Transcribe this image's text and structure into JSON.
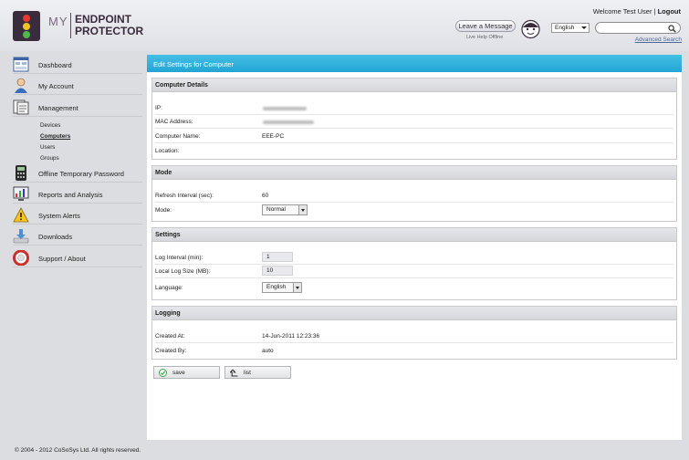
{
  "header": {
    "brand_my": "MY",
    "brand_line1": "ENDPOINT",
    "brand_line2": "PROTECTOR",
    "welcome_text": "Welcome Test User",
    "separator": "|",
    "logout_label": "Logout",
    "leave_message_label": "Leave a Message",
    "live_help_status": "Live Help Offline",
    "language_selected": "English",
    "search_value": "",
    "advanced_search_label": "Advanced Search"
  },
  "sidebar": {
    "items": [
      {
        "label": "Dashboard",
        "icon": "dashboard-icon"
      },
      {
        "label": "My Account",
        "icon": "user-icon"
      },
      {
        "label": "Management",
        "icon": "management-icon"
      },
      {
        "label": "Offline Temporary Password",
        "icon": "calculator-icon"
      },
      {
        "label": "Reports and Analysis",
        "icon": "reports-icon"
      },
      {
        "label": "System Alerts",
        "icon": "warning-icon"
      },
      {
        "label": "Downloads",
        "icon": "download-icon"
      },
      {
        "label": "Support / About",
        "icon": "lifebuoy-icon"
      }
    ],
    "management_sub": [
      "Devices",
      "Computers",
      "Users",
      "Groups"
    ],
    "active_sub": "Computers"
  },
  "main": {
    "title": "Edit Settings for Computer",
    "computer_details": {
      "heading": "Computer Details",
      "ip_label": "IP:",
      "mac_label": "MAC Address:",
      "name_label": "Computer Name:",
      "name_value": "EEE-PC",
      "location_label": "Location:",
      "location_value": ""
    },
    "mode": {
      "heading": "Mode",
      "refresh_label": "Refresh Interval (sec):",
      "refresh_value": "60",
      "mode_label": "Mode:",
      "mode_value": "Normal"
    },
    "settings": {
      "heading": "Settings",
      "log_interval_label": "Log Interval (min):",
      "log_interval_value": "1",
      "local_log_label": "Local Log Size (MB):",
      "local_log_value": "10",
      "language_label": "Language:",
      "language_value": "English"
    },
    "logging": {
      "heading": "Logging",
      "created_at_label": "Created At:",
      "created_at_value": "14-Jun-2011 12:23:36",
      "created_by_label": "Created By:",
      "created_by_value": "auto"
    },
    "save_label": "save",
    "list_label": "list"
  },
  "footer": {
    "copyright": "© 2004 - 2012 CoSoSys Ltd. All rights reserved."
  },
  "colors": {
    "title_bar": "#22a5d4",
    "brand_dark": "#3a2b3d",
    "link": "#4b6a9a",
    "save_check": "#3aa64a"
  }
}
